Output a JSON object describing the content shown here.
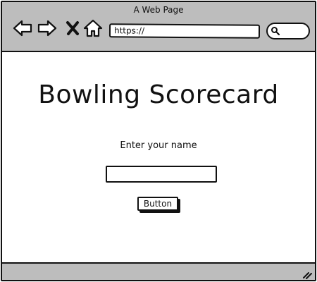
{
  "window": {
    "title": "A Web Page"
  },
  "browser": {
    "address": "https://"
  },
  "page": {
    "heading": "Bowling Scorecard",
    "name_label": "Enter your name",
    "name_value": "",
    "button_label": "Button"
  }
}
